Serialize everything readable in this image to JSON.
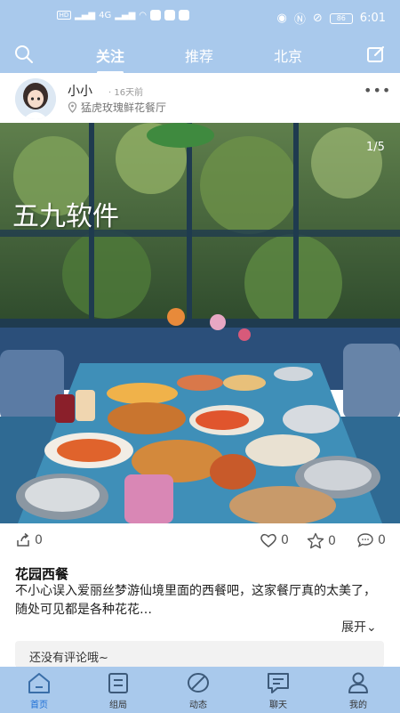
{
  "status_bar": {
    "time": "6:01",
    "battery": "86",
    "network": "4G"
  },
  "header": {
    "tabs": [
      {
        "label": "关注",
        "active": true
      },
      {
        "label": "推荐",
        "active": false
      },
      {
        "label": "北京",
        "active": false
      }
    ]
  },
  "post": {
    "user_name": "小小",
    "time_ago": "· 16天前",
    "location": "猛虎玫瑰鲜花餐厅",
    "image_counter": "1/5",
    "watermark": "五九软件",
    "share_count": "0",
    "like_count": "0",
    "favorite_count": "0",
    "comment_count": "0",
    "title": "花园西餐",
    "body": "不小心误入爱丽丝梦游仙境里面的西餐吧，这家餐厅真的太美了，随处可见都是各种花花…",
    "expand_label": "展开",
    "comments_placeholder": "还没有评论哦~"
  },
  "bottom_nav": [
    {
      "label": "首页",
      "icon": "home-icon",
      "active": true
    },
    {
      "label": "组局",
      "icon": "group-icon",
      "active": false
    },
    {
      "label": "动态",
      "icon": "leaf-icon",
      "active": false
    },
    {
      "label": "聊天",
      "icon": "chat-icon",
      "active": false
    },
    {
      "label": "我的",
      "icon": "profile-icon",
      "active": false
    }
  ],
  "colors": {
    "bar": "#a9c9ec",
    "accent": "#1e6fd6"
  }
}
